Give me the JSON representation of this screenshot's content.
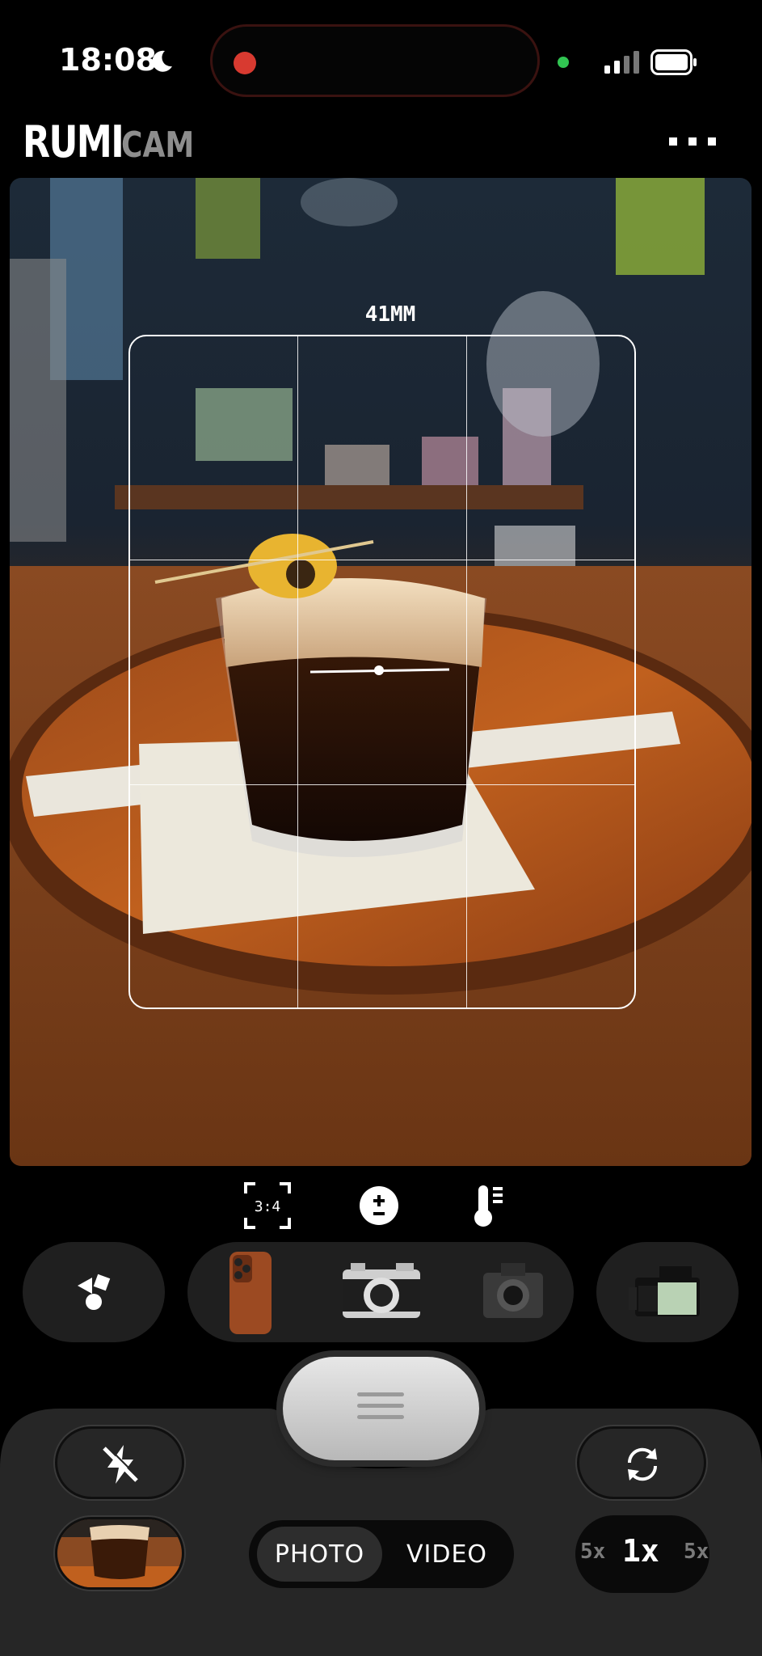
{
  "status_bar": {
    "time": "18:08"
  },
  "header": {
    "brand": "RUMI",
    "brand_sub": "CAM"
  },
  "viewfinder": {
    "focal_length": "41MM"
  },
  "quick_controls": {
    "aspect_ratio": "3:4"
  },
  "modes": {
    "photo": "PHOTO",
    "video": "VIDEO",
    "selected": "PHOTO"
  },
  "zoom": {
    "left": "5x",
    "current": "1x",
    "right": "5x"
  },
  "colors": {
    "accent_red": "#d83a30",
    "privacy_green": "#31c552",
    "panel": "#262626"
  }
}
